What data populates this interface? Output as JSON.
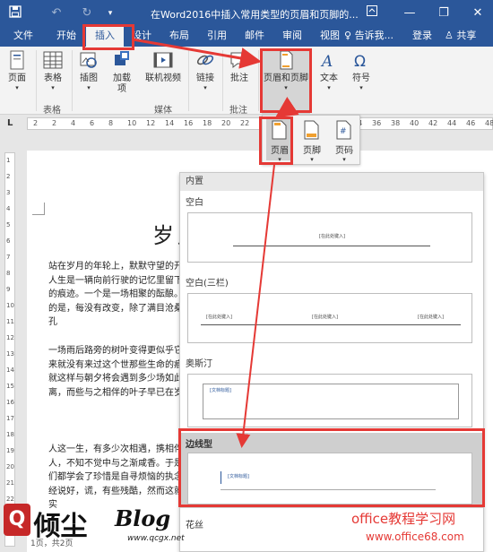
{
  "titlebar": {
    "title": "在Word2016中插入常用类型的页眉和页脚的...",
    "save_icon": "save-icon",
    "undo_icon": "undo-icon",
    "redo_icon": "redo-icon",
    "ribbon_display_icon": "ribbon-display-icon",
    "minimize_icon": "minimize-icon",
    "restore_icon": "restore-icon",
    "close_icon": "close-icon"
  },
  "tabs": [
    "文件",
    "开始",
    "插入",
    "设计",
    "布局",
    "引用",
    "邮件",
    "审阅",
    "视图"
  ],
  "tab_right": {
    "tell_me": "告诉我...",
    "login": "登录",
    "share": "共享"
  },
  "ribbon": {
    "buttons": [
      {
        "label": "页面",
        "caret": "▾"
      },
      {
        "label": "表格",
        "caret": "▾"
      },
      {
        "label": "插图",
        "caret": "▾"
      },
      {
        "label": "加载",
        "label2": "项",
        "caret": "▾"
      },
      {
        "label": "联机视频"
      },
      {
        "label": "链接",
        "caret": "▾"
      },
      {
        "label": "批注"
      },
      {
        "label": "页眉和页脚",
        "caret": "▾"
      },
      {
        "label": "文本",
        "caret": "▾"
      },
      {
        "label": "符号",
        "caret": "▾"
      }
    ],
    "groups": [
      "表格",
      "媒体",
      "批注"
    ]
  },
  "subpanel": {
    "header": "页眉",
    "footer": "页脚",
    "page_number": "页码",
    "caret": "▾"
  },
  "ruler": {
    "ticks": [
      "2",
      "2",
      "4",
      "6",
      "8",
      "10",
      "12",
      "14",
      "16",
      "18",
      "20",
      "22",
      "24",
      "26",
      "28",
      "30",
      "32",
      "34",
      "36",
      "38",
      "40",
      "42",
      "44",
      "46",
      "48"
    ]
  },
  "vruler": {
    "ticks": [
      "1",
      "2",
      "3",
      "4",
      "5",
      "6",
      "7",
      "8",
      "9",
      "10",
      "11",
      "12",
      "13",
      "14",
      "15",
      "16",
      "17",
      "18",
      "19",
      "20",
      "21",
      "22",
      "23",
      "24"
    ]
  },
  "document": {
    "title": "岁月",
    "paragraphs": [
      "站在岁月的年轮上，默默守望的开始。人生是一辆向前行驶的记忆里留下斑驳的痕迹。一个是一场相聚的酝酿。不同的是，每没有改变，除了满目沧桑的面孔",
      "一场雨后路旁的树叶变得更似乎它们从来就没有来过这个世那些生命的痕迹，就这样与朝夕将会遇到多少场如此的别离，而些与之相伴的叶子早已在岁月的",
      "人这一生，有多少次相遇，携相伴的人，不知不觉中与之渐咸香。于是，我们都学会了珍惜是自寻烦恼的执念。曾经说好，谎，有些残酷，然而这就是事实"
    ],
    "status": "1页，共2页"
  },
  "gallery": {
    "header": "内置",
    "sections": [
      {
        "name": "空白",
        "placeholders": [
          "[在此处键入]"
        ]
      },
      {
        "name": "空白(三栏)",
        "placeholders": [
          "[在此处键入]",
          "[在此处键入]",
          "[在此处键入]"
        ]
      },
      {
        "name": "奥斯汀",
        "placeholders": [
          "[文档标题]"
        ]
      },
      {
        "name": "边线型",
        "placeholders": [
          "[文档标题]"
        ]
      },
      {
        "name": "花丝",
        "placeholders": []
      }
    ]
  },
  "watermarks": {
    "brand": "倾尘",
    "blog": "Blog",
    "blog_url": "www.qcgx.net",
    "site_name": "office教程学习网",
    "site_url": "www.office68.com"
  },
  "colors": {
    "accent": "#2b579a",
    "highlight": "#e53935",
    "site_name": "#e53935"
  }
}
